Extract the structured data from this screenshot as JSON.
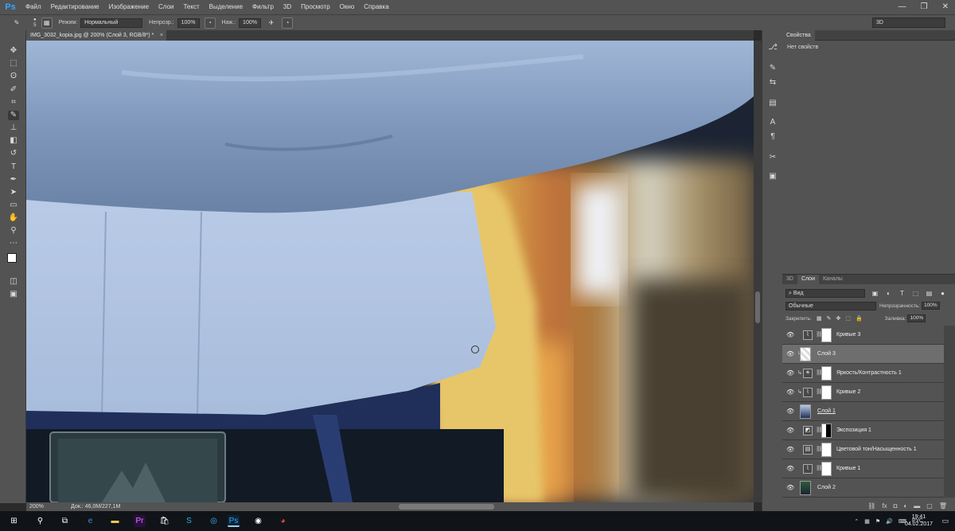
{
  "menubar": {
    "logo": "Ps",
    "items": [
      "Файл",
      "Редактирование",
      "Изображение",
      "Слои",
      "Текст",
      "Выделение",
      "Фильтр",
      "3D",
      "Просмотр",
      "Окно",
      "Справка"
    ],
    "minimize": "—",
    "restore": "❐",
    "close": "✕"
  },
  "options": {
    "brush_size": "5",
    "mode_label": "Режим:",
    "mode_value": "Нормальный",
    "opacity_label": "Непрозр.:",
    "opacity_value": "100%",
    "flow_label": "Наж.:",
    "flow_value": "100%",
    "workspace": "3D"
  },
  "document": {
    "tab_title": "IMG_3032_kopia.jpg @ 200% (Слой 3, RGB/8*) *",
    "tab_close": "×",
    "zoom": "200%",
    "doc_size": "Док.: 46,0M/227,1M"
  },
  "properties": {
    "title": "Свойства",
    "empty": "Нет свойств"
  },
  "layers_panel": {
    "tabs": [
      "3D",
      "Слои",
      "Каналы"
    ],
    "filter": "Вид",
    "blend_mode": "Обычные",
    "opacity_label": "Непрозрачность:",
    "opacity_value": "100%",
    "lock_label": "Закрепить:",
    "fill_label": "Заливка:",
    "fill_value": "100%",
    "layers": [
      {
        "name": "Кривые 3",
        "type": "adjustment",
        "icon": "curves-icon",
        "glyph": "⌇",
        "clip": false,
        "selected": false
      },
      {
        "name": "Слой 3",
        "type": "pixel",
        "clip": true,
        "selected": true
      },
      {
        "name": "Яркость/Контрастность 1",
        "type": "adjustment",
        "icon": "brightness-icon",
        "glyph": "☀",
        "clip": true,
        "selected": false
      },
      {
        "name": "Кривые 2",
        "type": "adjustment",
        "icon": "curves-icon",
        "glyph": "⌇",
        "clip": true,
        "selected": false
      },
      {
        "name": "Слой 1",
        "type": "pixel",
        "clip": false,
        "selected": false,
        "underline": true
      },
      {
        "name": "Экспозиция 1",
        "type": "adjustment",
        "icon": "exposure-icon",
        "glyph": "◩",
        "clip": false,
        "selected": false,
        "mask": "black"
      },
      {
        "name": "Цветовой тон/Насыщенность 1",
        "type": "adjustment",
        "icon": "hue-saturation-icon",
        "glyph": "▤",
        "clip": false,
        "selected": false
      },
      {
        "name": "Кривые 1",
        "type": "adjustment",
        "icon": "curves-icon",
        "glyph": "⌇",
        "clip": false,
        "selected": false
      },
      {
        "name": "Слой 2",
        "type": "pixel",
        "clip": false,
        "selected": false
      }
    ]
  },
  "taskbar": {
    "language": "РУС",
    "time": "19:41",
    "date": "04.02.2017"
  }
}
